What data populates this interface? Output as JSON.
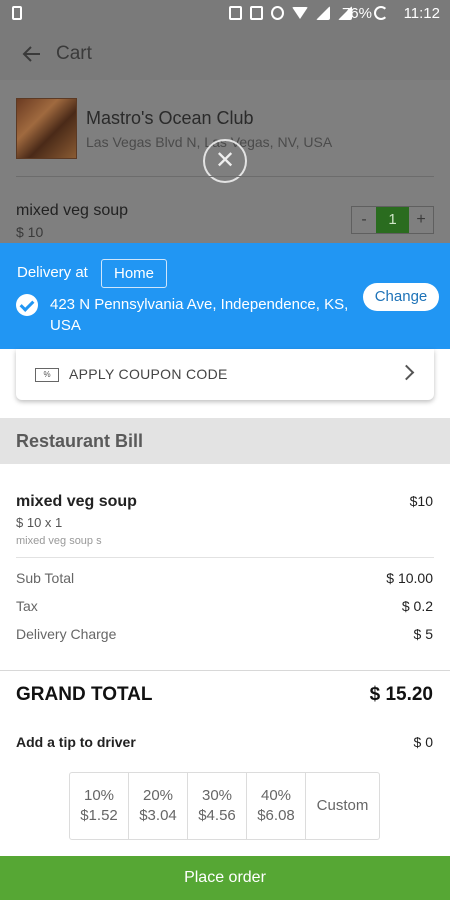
{
  "status_bar": {
    "battery": "76%",
    "time": "11:12"
  },
  "header": {
    "title": "Cart"
  },
  "restaurant": {
    "name": "Mastro's Ocean Club",
    "address": "Las Vegas Blvd N, Las Vegas, NV, USA"
  },
  "cart_item": {
    "name": "mixed veg soup",
    "price": "$ 10",
    "quantity": "1",
    "minus": "-",
    "plus": "+"
  },
  "close_glyph": "✕",
  "delivery": {
    "label": "Delivery at",
    "chip": "Home",
    "address": "423 N Pennsylvania Ave, Independence, KS, USA",
    "change": "Change"
  },
  "coupon": {
    "label": "APPLY COUPON CODE",
    "icon_text": "%"
  },
  "bill": {
    "title": "Restaurant Bill",
    "item": {
      "name": "mixed veg soup",
      "amount": "$10",
      "qty_line": "$ 10 x 1",
      "description": "mixed veg soup s"
    },
    "sub_total_label": "Sub Total",
    "sub_total": "$ 10.00",
    "tax_label": "Tax",
    "tax": "$ 0.2",
    "delivery_label": "Delivery Charge",
    "delivery": "$ 5",
    "grand_label": "GRAND TOTAL",
    "grand": "$ 15.20",
    "tip_label": "Add a tip to driver",
    "tip": "$ 0"
  },
  "tips": [
    {
      "pct": "10%",
      "amt": "$1.52"
    },
    {
      "pct": "20%",
      "amt": "$3.04"
    },
    {
      "pct": "30%",
      "amt": "$4.56"
    },
    {
      "pct": "40%",
      "amt": "$6.08"
    }
  ],
  "tip_custom": "Custom",
  "place_order": "Place order"
}
